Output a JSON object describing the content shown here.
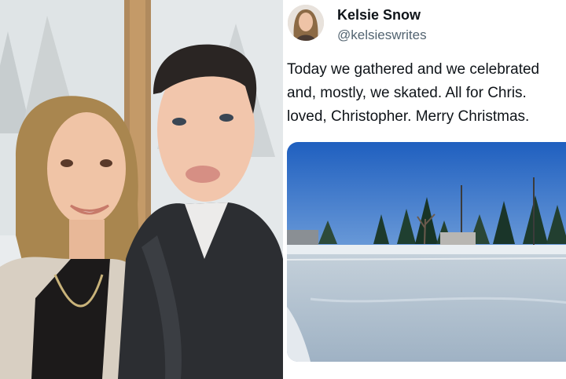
{
  "post": {
    "display_name": "Kelsie Snow",
    "handle": "@kelsieswrites",
    "text_lines": [
      "Today we gathered and we celebrated",
      "and, mostly, we skated. All for Chris.",
      "loved, Christopher. Merry Christmas."
    ]
  },
  "icons": {
    "avatar": "avatar-photo",
    "left_photo": "selfie-photo",
    "media": "ice-rink-photo"
  },
  "colors": {
    "name_text": "#0f1419",
    "handle_text": "#536471",
    "sky": "#2f6fc9",
    "ice": "#aebfcf"
  }
}
